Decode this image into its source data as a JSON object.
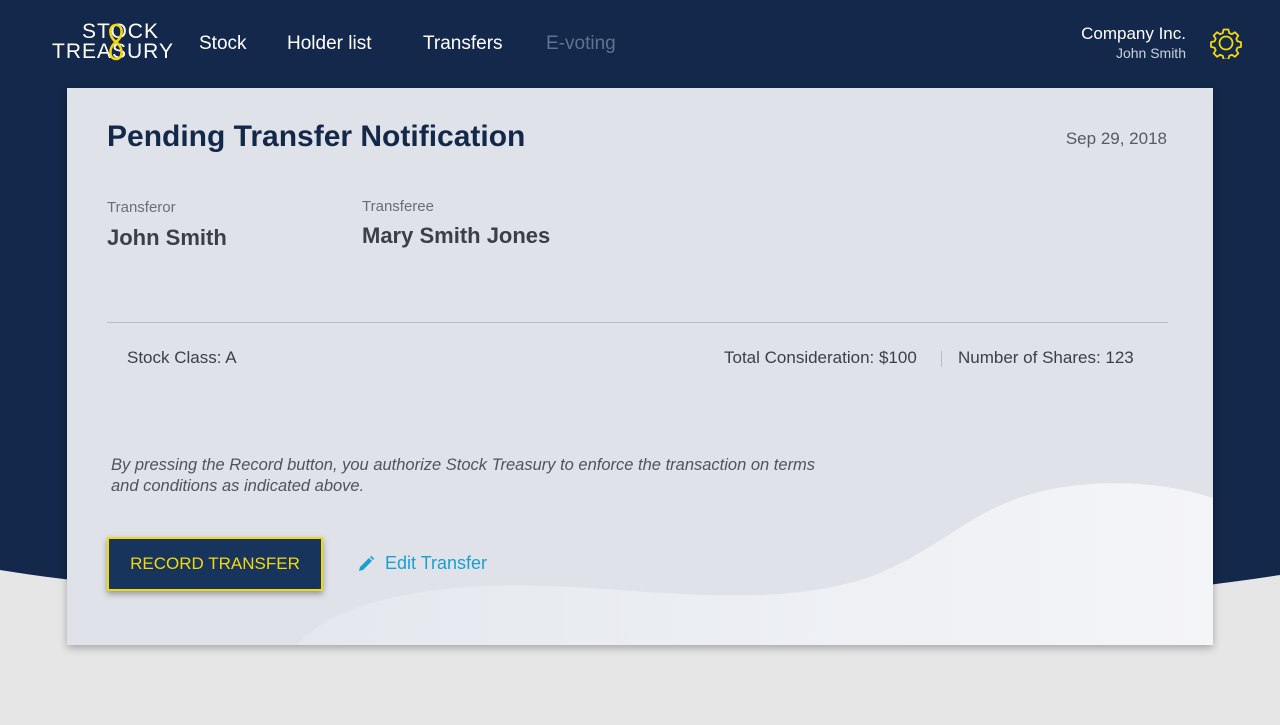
{
  "brand": {
    "logo_line1": "STOCK",
    "logo_line2": "TREASURY",
    "colors": {
      "navy": "#13284a",
      "accent": "#f5d90f",
      "link": "#1a9fd0"
    }
  },
  "nav": {
    "items": [
      {
        "label": "Stock",
        "disabled": false
      },
      {
        "label": "Holder list",
        "disabled": false
      },
      {
        "label": "Transfers",
        "disabled": false
      },
      {
        "label": "E-voting",
        "disabled": true
      }
    ]
  },
  "account": {
    "company": "Company Inc.",
    "user": "John Smith",
    "settings_icon": "gear-icon"
  },
  "notification": {
    "title": "Pending Transfer Notification",
    "date": "Sep 29, 2018",
    "transferor_label": "Transferor",
    "transferor_name": "John Smith",
    "transferee_label": "Transferee",
    "transferee_name": "Mary Smith Jones",
    "stock_class": "Stock Class: A",
    "total_consideration": "Total Consideration: $100",
    "number_of_shares": "Number of Shares: 123",
    "disclaimer": "By pressing the Record button, you authorize Stock Treasury to enforce the transaction on terms and conditions as indicated above.",
    "record_button": "RECORD TRANSFER",
    "edit_link": "Edit Transfer",
    "edit_icon": "pencil-icon"
  }
}
